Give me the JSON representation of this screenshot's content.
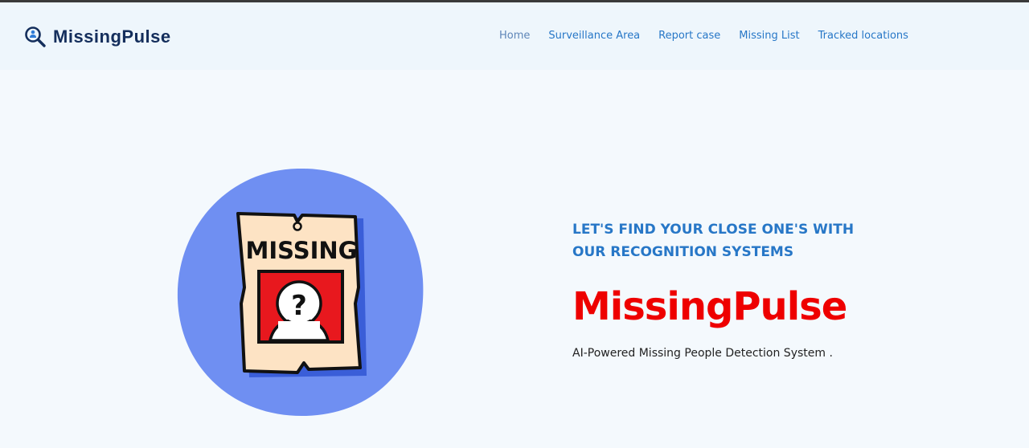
{
  "brand": {
    "name": "MissingPulse",
    "icon": "magnifier-person-icon"
  },
  "nav": {
    "items": [
      {
        "label": "Home"
      },
      {
        "label": "Surveillance Area"
      },
      {
        "label": "Report case"
      },
      {
        "label": "Missing List"
      },
      {
        "label": "Tracked locations"
      }
    ]
  },
  "hero": {
    "tagline": "LET'S FIND YOUR CLOSE ONE'S WITH OUR RECOGNITION SYSTEMS",
    "title": "MissingPulse",
    "subtitle": "AI-Powered Missing People Detection System .",
    "poster_text": "MISSING",
    "poster_symbol": "?"
  },
  "colors": {
    "accent": "#2777c7",
    "title_red": "#ee0000",
    "brand_navy": "#142e5c",
    "circle_blue": "#6f8ff2",
    "poster_paper": "#fde3c4",
    "poster_red": "#e8181e"
  }
}
